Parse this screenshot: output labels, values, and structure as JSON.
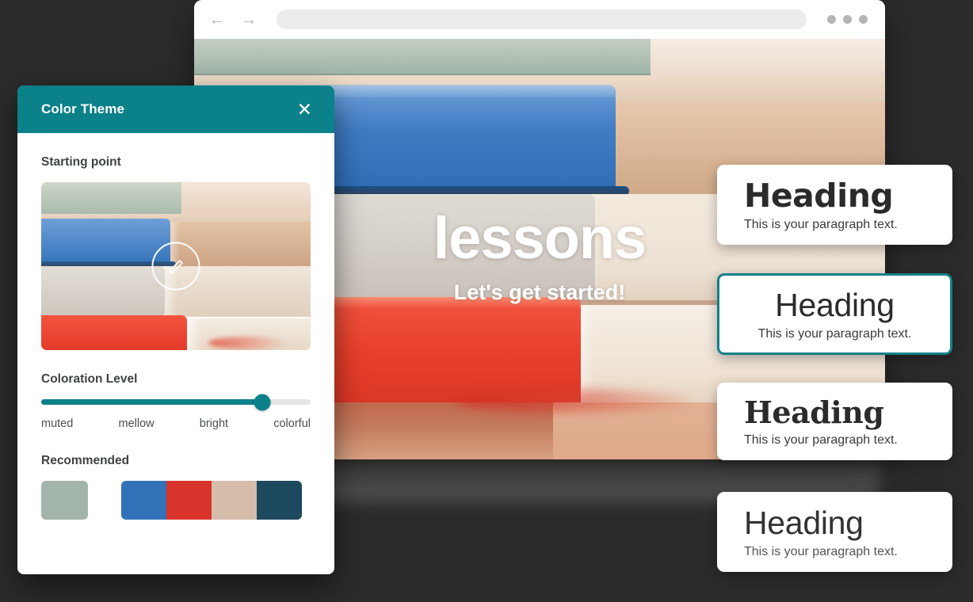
{
  "browser": {
    "back_icon": "←",
    "forward_icon": "→",
    "address_value": "",
    "address_placeholder": "",
    "menu_icon": "kebab-menu-icon"
  },
  "hero": {
    "title": "lessons",
    "subtitle": "Let's get started!"
  },
  "text_style_cards": [
    {
      "heading": "Heading",
      "paragraph": "This is your paragraph text.",
      "selected": false
    },
    {
      "heading": "Heading",
      "paragraph": "This is your paragraph text.",
      "selected": true
    },
    {
      "heading": "Heading",
      "paragraph": "This is your paragraph text.",
      "selected": false
    },
    {
      "heading": "Heading",
      "paragraph": "This is your paragraph text.",
      "selected": false
    }
  ],
  "panel": {
    "title": "Color Theme",
    "close_label": "✕",
    "starting_point": {
      "label": "Starting point",
      "edit_icon": "pencil-icon"
    },
    "coloration": {
      "label": "Coloration Level",
      "value_percent": 82,
      "ticks": [
        "muted",
        "mellow",
        "bright",
        "colorful"
      ]
    },
    "recommended": {
      "label": "Recommended",
      "solid_swatch": "#a3b5ab",
      "palette": [
        "#3172b9",
        "#d9342b",
        "#d5bcab",
        "#1d4a5e"
      ]
    }
  },
  "colors": {
    "accent_teal": "#0b8189",
    "page_background": "#2b2b2b",
    "selected_border": "#13808a"
  }
}
